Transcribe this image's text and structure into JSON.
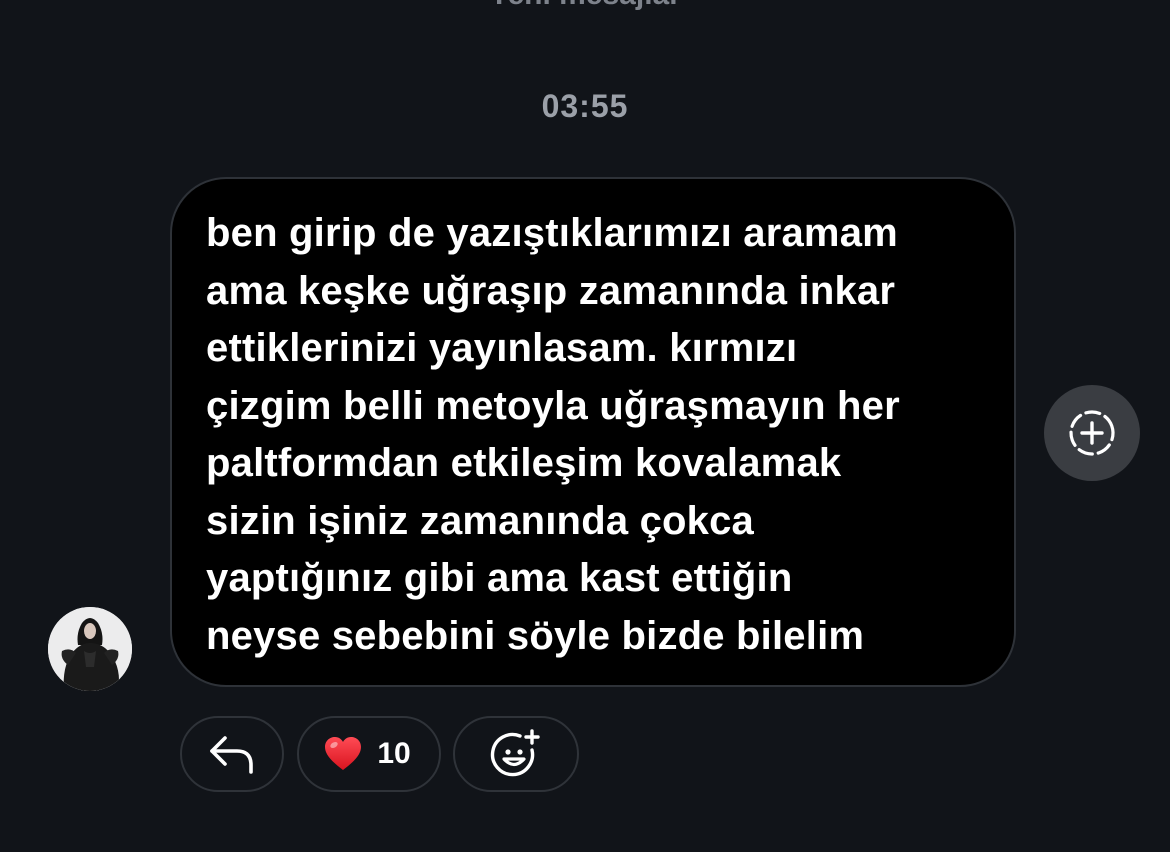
{
  "header": {
    "partial_label": "Yeni mesajlar",
    "timestamp": "03:55"
  },
  "message": {
    "lines": [
      "ben girip de yazıştıklarımızı aramam",
      "ama keşke uğraşıp zamanında inkar",
      "ettiklerinizi yayınlasam. kırmızı",
      "çizgim belli metoyla uğraşmayın her",
      "paltformdan etkileşim kovalamak",
      "sizin işiniz zamanında çokca",
      "yaptığınız gibi ama kast ettiğin",
      "neyse sebebini söyle bizde bilelim"
    ]
  },
  "reactions": {
    "heart_count": "10"
  },
  "icons": {
    "reply": "reply-arrow-icon",
    "heart": "heart-icon",
    "emoji": "add-emoji-icon",
    "add": "add-circle-icon",
    "avatar": "avatar"
  },
  "colors": {
    "background": "#111419",
    "bubble": "#000000",
    "heart": "#e8212e",
    "muted_text": "#9ba0a8"
  }
}
